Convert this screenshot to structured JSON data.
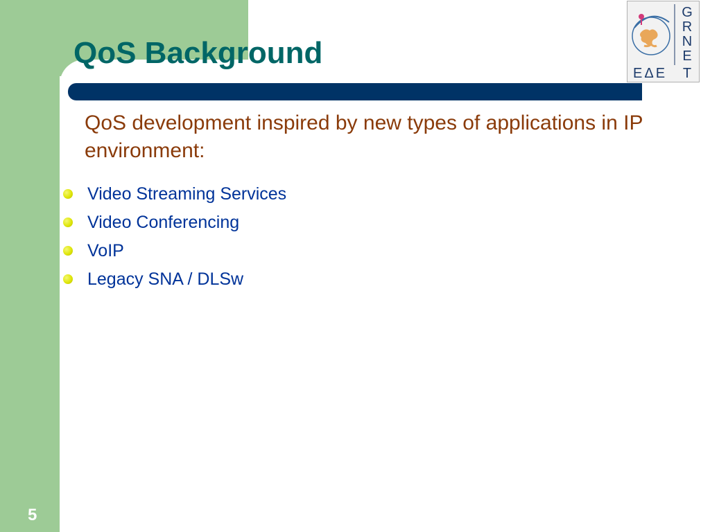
{
  "slide": {
    "title": "QoS Background",
    "subtitle": "QoS development inspired by new types of applications in IP environment:",
    "bullets": [
      "Video Streaming Services",
      "Video Conferencing",
      "VoIP",
      "Legacy SNA / DLSw"
    ],
    "page_number": "5"
  },
  "logo": {
    "latin_letters": "GRNET",
    "greek_letters": "ΕΔΕΤ"
  },
  "colors": {
    "frame_green": "#9dcb96",
    "title_teal": "#006666",
    "bar_navy": "#003366",
    "subtitle_brown": "#8a3b0a",
    "bullet_text_blue": "#003399",
    "bullet_yellow": "#dfe60a"
  },
  "icons": {
    "bullet": "yellow-dot-icon",
    "logo": "grnet-logo"
  }
}
